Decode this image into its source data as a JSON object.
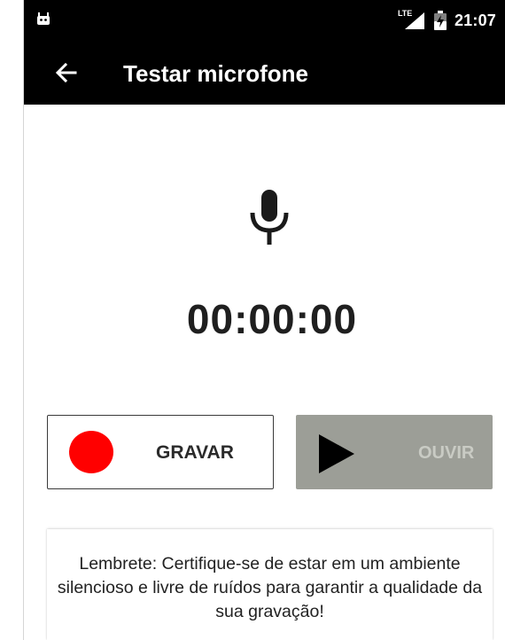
{
  "status_bar": {
    "time": "21:07",
    "network_label": "LTE",
    "icons": [
      "android-notification-icon",
      "signal-icon",
      "battery-icon"
    ]
  },
  "app_bar": {
    "title": "Testar microfone",
    "back_icon": "arrow-back-icon",
    "background": "#000000"
  },
  "recorder": {
    "mic_icon": "microphone-icon",
    "timer": "00:00:00",
    "record_button": {
      "label": "GRAVAR",
      "dot_color": "#ff0000"
    },
    "play_button": {
      "label": "OUVIR",
      "icon": "play-icon",
      "background": "#9c9e97",
      "enabled": false
    }
  },
  "reminder": {
    "text": "Lembrete: Certifique-se de estar em um ambiente silencioso e livre de ruídos para garantir a qualidade da sua gravação!"
  }
}
